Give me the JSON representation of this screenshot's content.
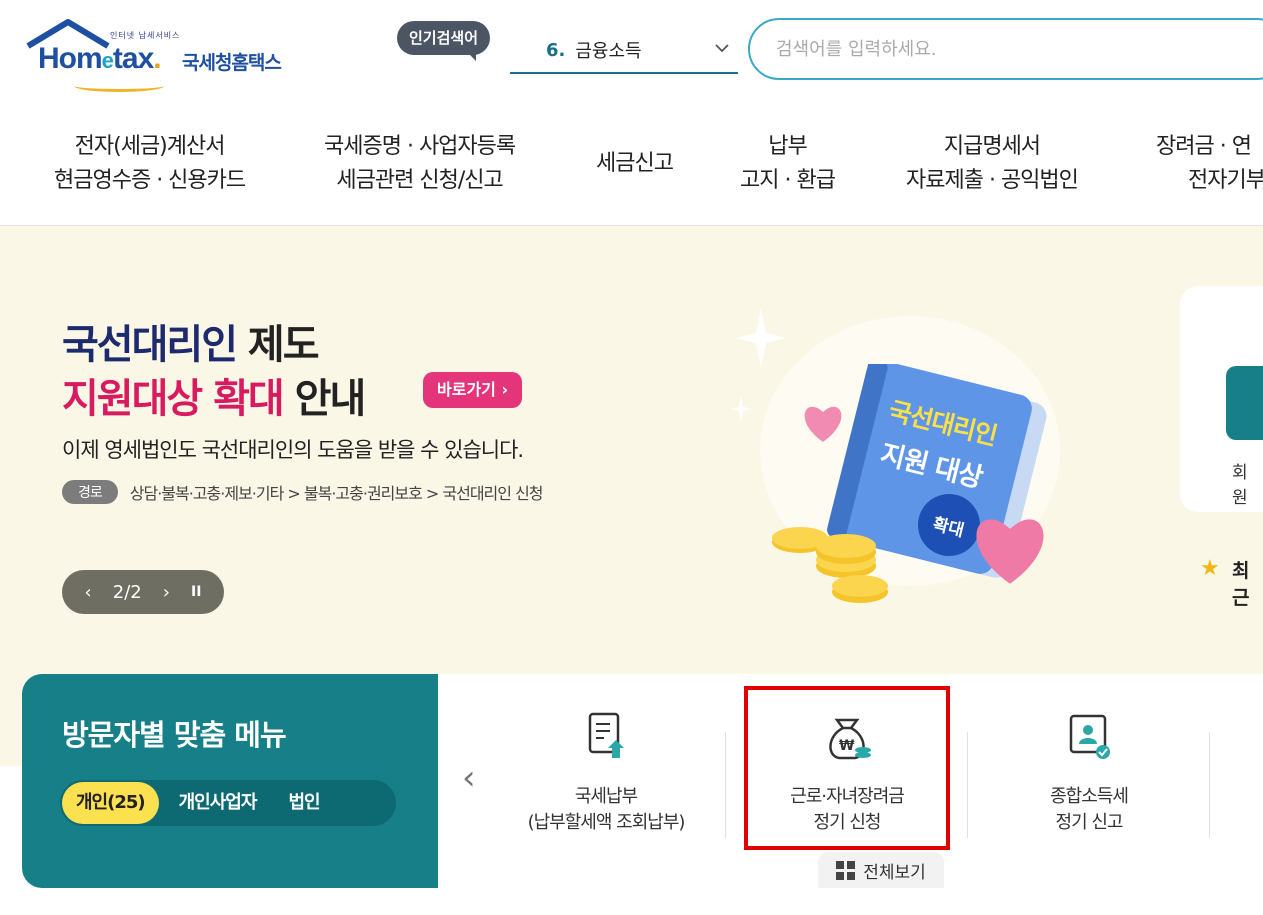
{
  "header": {
    "logo_small": "인터넷 납세서비스",
    "logo_name_prefix": "Hom",
    "logo_name_e": "e",
    "logo_name_suffix": "tax",
    "logo_name_dot": ".",
    "logo_korean": "국세청홈택스",
    "popular_badge": "인기검색어",
    "popular_rank": "6.",
    "popular_term": "금융소득",
    "search_placeholder": "검색어를 입력하세요."
  },
  "nav": [
    {
      "line1": "전자(세금)계산서",
      "line2": "현금영수증 · 신용카드"
    },
    {
      "line1": "국세증명 · 사업자등록",
      "line2": "세금관련 신청/신고"
    },
    {
      "line1": "세금신고",
      "line2": ""
    },
    {
      "line1": "납부",
      "line2": "고지 · 환급"
    },
    {
      "line1": "지급명세서",
      "line2": "자료제출 · 공익법인"
    },
    {
      "line1": "장려금 · 연",
      "line2": "전자기부"
    }
  ],
  "banner": {
    "title1_blue": "국선대리인",
    "title1_black": " 제도",
    "title2_pink": "지원대상 확대",
    "title2_black": " 안내",
    "go_button": "바로가기 ›",
    "subtitle": "이제 영세법인도 국선대리인의 도움을 받을 수 있습니다.",
    "path_tag": "경로",
    "path_text": "상담·불복·고충·제보·기타 > 불복·고충·권리보호 > 국선대리인 신청",
    "pager_prev": "‹",
    "pager_text": "2/2",
    "pager_next": "›",
    "pager_pause": "II",
    "book_line1": "국선대리인",
    "book_line2": "지원 대상",
    "book_badge": "확대",
    "side_label1": "회원",
    "side_label2": "최근"
  },
  "quick_menu": {
    "title": "방문자별 맞춤 메뉴",
    "tabs": [
      "개인(25)",
      "개인사업자",
      "법인"
    ],
    "prev_arrow": "‹",
    "items": [
      {
        "line1": "국세납부",
        "line2": "(납부할세액 조회납부)",
        "icon": "tax-document-upload-icon"
      },
      {
        "line1": "근로·자녀장려금",
        "line2": "정기 신청",
        "icon": "money-bag-icon"
      },
      {
        "line1": "종합소득세",
        "line2": "정기 신고",
        "icon": "person-certificate-icon"
      }
    ],
    "view_all": "전체보기"
  },
  "colors": {
    "brand_blue": "#1f4fa0",
    "teal": "#177f88",
    "pink": "#d81b60",
    "banner_bg": "#fbf7e6",
    "highlight_red": "#e00000"
  }
}
